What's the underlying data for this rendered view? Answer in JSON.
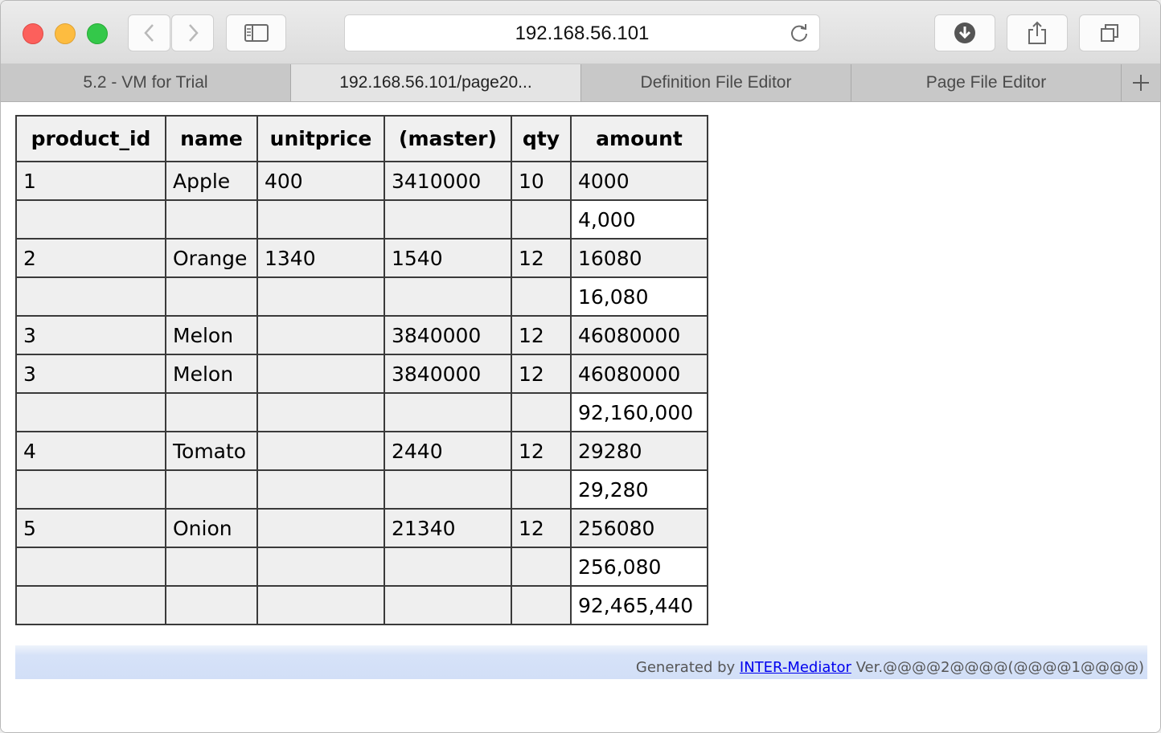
{
  "browser": {
    "url": "192.168.56.101",
    "icons": [
      "back-icon",
      "forward-icon",
      "sidebar-icon",
      "reload-icon",
      "download-icon",
      "share-icon",
      "tabs-icon",
      "new-tab-icon"
    ]
  },
  "tabs": [
    {
      "label": "5.2 - VM for Trial"
    },
    {
      "label": "192.168.56.101/page20..."
    },
    {
      "label": "Definition File Editor"
    },
    {
      "label": "Page File Editor"
    }
  ],
  "table": {
    "headers": [
      "product_id",
      "name",
      "unitprice",
      "(master)",
      "qty",
      "amount"
    ],
    "rows": [
      {
        "product_id": "1",
        "name": "Apple",
        "unitprice": "400",
        "master": "3410000",
        "qty": "10",
        "amount": "4000"
      },
      {
        "product_id": "",
        "name": "",
        "unitprice": "",
        "master": "",
        "qty": "",
        "amount": "4,000"
      },
      {
        "product_id": "2",
        "name": "Orange",
        "unitprice": "1340",
        "master": "1540",
        "qty": "12",
        "amount": "16080"
      },
      {
        "product_id": "",
        "name": "",
        "unitprice": "",
        "master": "",
        "qty": "",
        "amount": "16,080"
      },
      {
        "product_id": "3",
        "name": "Melon",
        "unitprice": "",
        "master": "3840000",
        "qty": "12",
        "amount": "46080000"
      },
      {
        "product_id": "3",
        "name": "Melon",
        "unitprice": "",
        "master": "3840000",
        "qty": "12",
        "amount": "46080000"
      },
      {
        "product_id": "",
        "name": "",
        "unitprice": "",
        "master": "",
        "qty": "",
        "amount": "92,160,000"
      },
      {
        "product_id": "4",
        "name": "Tomato",
        "unitprice": "",
        "master": "2440",
        "qty": "12",
        "amount": "29280"
      },
      {
        "product_id": "",
        "name": "",
        "unitprice": "",
        "master": "",
        "qty": "",
        "amount": "29,280"
      },
      {
        "product_id": "5",
        "name": "Onion",
        "unitprice": "",
        "master": "21340",
        "qty": "12",
        "amount": "256080"
      },
      {
        "product_id": "",
        "name": "",
        "unitprice": "",
        "master": "",
        "qty": "",
        "amount": "256,080"
      },
      {
        "product_id": "",
        "name": "",
        "unitprice": "",
        "master": "",
        "qty": "",
        "amount": "92,465,440"
      }
    ]
  },
  "footer": {
    "prefix": "Generated by ",
    "link": "INTER-Mediator",
    "suffix": " Ver.@@@@2@@@@(@@@@1@@@@)"
  }
}
